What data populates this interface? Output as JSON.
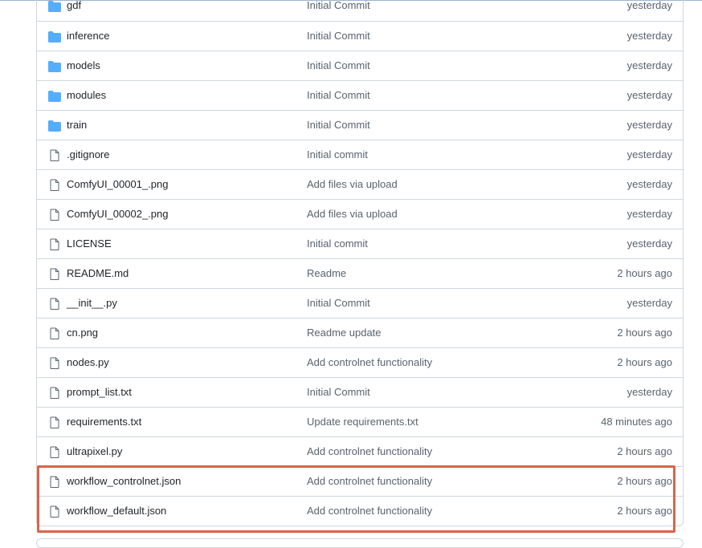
{
  "colors": {
    "folder": "#54aeff",
    "highlight": "#d9654a"
  },
  "files": [
    {
      "type": "folder",
      "name": "gdf",
      "message": "Initial Commit",
      "date": "yesterday"
    },
    {
      "type": "folder",
      "name": "inference",
      "message": "Initial Commit",
      "date": "yesterday"
    },
    {
      "type": "folder",
      "name": "models",
      "message": "Initial Commit",
      "date": "yesterday"
    },
    {
      "type": "folder",
      "name": "modules",
      "message": "Initial Commit",
      "date": "yesterday"
    },
    {
      "type": "folder",
      "name": "train",
      "message": "Initial Commit",
      "date": "yesterday"
    },
    {
      "type": "file",
      "name": ".gitignore",
      "message": "Initial commit",
      "date": "yesterday"
    },
    {
      "type": "file",
      "name": "ComfyUI_00001_.png",
      "message": "Add files via upload",
      "date": "yesterday"
    },
    {
      "type": "file",
      "name": "ComfyUI_00002_.png",
      "message": "Add files via upload",
      "date": "yesterday"
    },
    {
      "type": "file",
      "name": "LICENSE",
      "message": "Initial commit",
      "date": "yesterday"
    },
    {
      "type": "file",
      "name": "README.md",
      "message": "Readme",
      "date": "2 hours ago"
    },
    {
      "type": "file",
      "name": "__init__.py",
      "message": "Initial Commit",
      "date": "yesterday"
    },
    {
      "type": "file",
      "name": "cn.png",
      "message": "Readme update",
      "date": "2 hours ago"
    },
    {
      "type": "file",
      "name": "nodes.py",
      "message": "Add controlnet functionality",
      "date": "2 hours ago"
    },
    {
      "type": "file",
      "name": "prompt_list.txt",
      "message": "Initial Commit",
      "date": "yesterday"
    },
    {
      "type": "file",
      "name": "requirements.txt",
      "message": "Update requirements.txt",
      "date": "48 minutes ago"
    },
    {
      "type": "file",
      "name": "ultrapixel.py",
      "message": "Add controlnet functionality",
      "date": "2 hours ago"
    },
    {
      "type": "file",
      "name": "workflow_controlnet.json",
      "message": "Add controlnet functionality",
      "date": "2 hours ago"
    },
    {
      "type": "file",
      "name": "workflow_default.json",
      "message": "Add controlnet functionality",
      "date": "2 hours ago"
    }
  ]
}
